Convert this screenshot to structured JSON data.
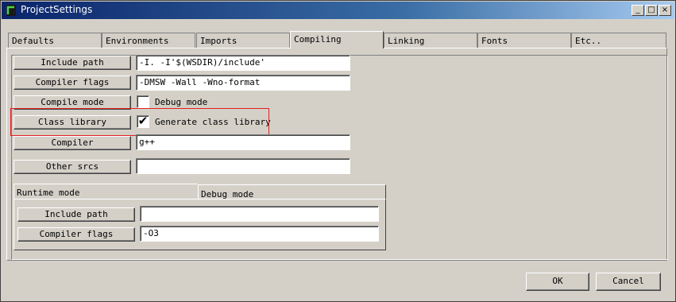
{
  "window": {
    "title": "ProjectSettings",
    "controls": {
      "minimize": "_",
      "maximize": "□",
      "close": "×"
    }
  },
  "tabs": [
    {
      "label": "Defaults"
    },
    {
      "label": "Environments"
    },
    {
      "label": "Imports"
    },
    {
      "label": "Compiling",
      "active": true
    },
    {
      "label": "Linking"
    },
    {
      "label": "Fonts"
    },
    {
      "label": "Etc.."
    }
  ],
  "compiling": {
    "include_path": {
      "button": "Include path",
      "value": "-I. -I'$(WSDIR)/include'"
    },
    "compiler_flags": {
      "button": "Compiler flags",
      "value": "-DMSW -Wall -Wno-format"
    },
    "compile_mode": {
      "button": "Compile mode",
      "checkbox_label": "Debug mode",
      "checked": false
    },
    "class_library": {
      "button": "Class library",
      "checkbox_label": "Generate class library",
      "checked": true
    },
    "compiler": {
      "button": "Compiler",
      "value": "g++"
    },
    "other_srcs": {
      "button": "Other srcs",
      "value": ""
    }
  },
  "mode_tabs": [
    {
      "label": "Runtime mode",
      "active": true
    },
    {
      "label": "Debug mode"
    }
  ],
  "runtime": {
    "include_path": {
      "button": "Include path",
      "value": ""
    },
    "compiler_flags": {
      "button": "Compiler flags",
      "value": "-O3"
    }
  },
  "footer": {
    "ok": "OK",
    "cancel": "Cancel"
  },
  "colors": {
    "highlight": "#e02020",
    "titlebar": "#0a246a"
  },
  "icons": {
    "app": "project-app-icon",
    "check": "checkmark-icon"
  }
}
